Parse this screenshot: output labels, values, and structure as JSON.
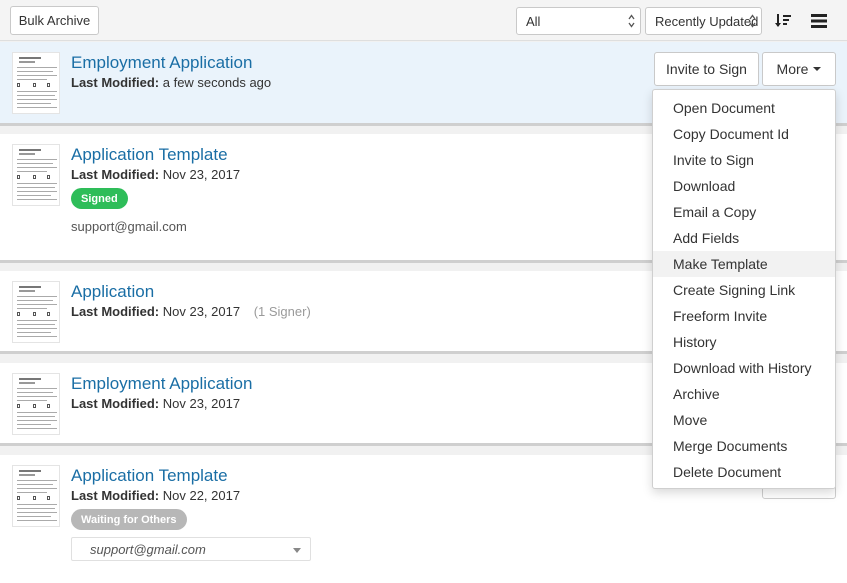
{
  "toolbar": {
    "bulk_archive": "Bulk Archive",
    "filter_value": "All",
    "sort_value": "Recently Updated"
  },
  "documents": [
    {
      "title": "Employment Application",
      "modified_label": "Last Modified:",
      "modified_value": "a few seconds ago"
    },
    {
      "title": "Application Template",
      "modified_label": "Last Modified:",
      "modified_value": "Nov 23, 2017",
      "badge": "Signed",
      "email": "support@gmail.com"
    },
    {
      "title": "Application",
      "modified_label": "Last Modified:",
      "modified_value": "Nov 23, 2017",
      "signers": "(1 Signer)"
    },
    {
      "title": "Employment Application",
      "modified_label": "Last Modified:",
      "modified_value": "Nov 23, 2017"
    },
    {
      "title": "Application Template",
      "modified_label": "Last Modified:",
      "modified_value": "Nov 22, 2017",
      "badge": "Waiting for Others",
      "email": "support@gmail.com"
    }
  ],
  "actions": {
    "invite_to_sign": "Invite to Sign",
    "more": "More"
  },
  "menu": [
    "Open Document",
    "Copy Document Id",
    "Invite to Sign",
    "Download",
    "Email a Copy",
    "Add Fields",
    "Make Template",
    "Create Signing Link",
    "Freeform Invite",
    "History",
    "Download with History",
    "Archive",
    "Move",
    "Merge Documents",
    "Delete Document"
  ],
  "colors": {
    "link": "#1a6ea5",
    "signed": "#2ebd59",
    "waiting": "#b7b7b7",
    "active_row": "#eaf3fb"
  }
}
